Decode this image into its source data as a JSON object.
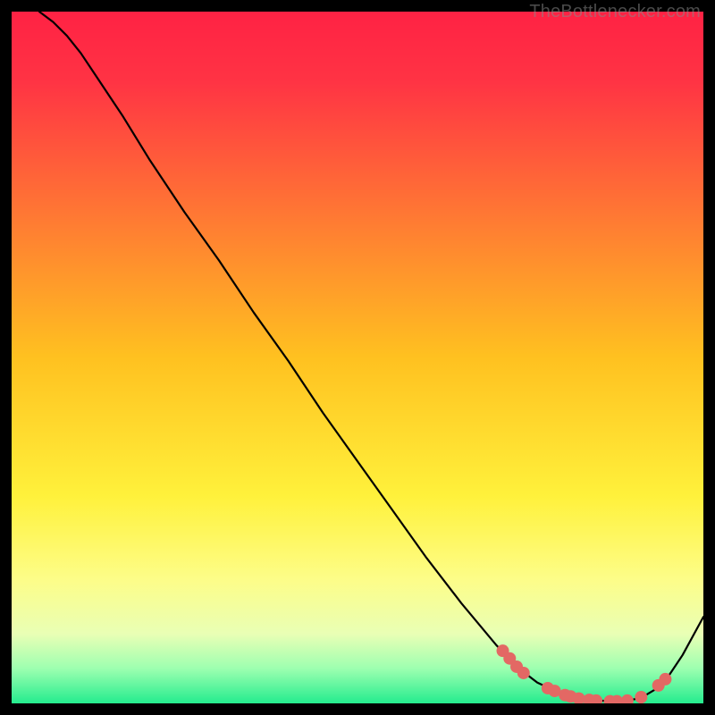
{
  "watermark": "TheBottlenecker.com",
  "chart_data": {
    "type": "line",
    "title": "",
    "xlabel": "",
    "ylabel": "",
    "xlim": [
      0,
      100
    ],
    "ylim": [
      0,
      100
    ],
    "background_gradient_stops": [
      {
        "pct": 0,
        "color": "#ff2244"
      },
      {
        "pct": 10,
        "color": "#ff3344"
      },
      {
        "pct": 30,
        "color": "#ff7a33"
      },
      {
        "pct": 50,
        "color": "#ffc120"
      },
      {
        "pct": 70,
        "color": "#fff13b"
      },
      {
        "pct": 82,
        "color": "#fdfd88"
      },
      {
        "pct": 90,
        "color": "#e9ffb5"
      },
      {
        "pct": 95,
        "color": "#9cffb0"
      },
      {
        "pct": 100,
        "color": "#24ec8e"
      }
    ],
    "series": [
      {
        "name": "bottleneck-curve",
        "color": "#000000",
        "x": [
          4,
          6,
          8,
          10,
          12,
          16,
          20,
          25,
          30,
          35,
          40,
          45,
          50,
          55,
          60,
          65,
          70,
          73,
          76,
          79,
          81,
          83,
          85,
          87,
          89,
          91,
          93,
          95,
          97,
          100
        ],
        "y": [
          100,
          98.5,
          96.5,
          94,
          91,
          85,
          78.5,
          71,
          64,
          56.5,
          49.5,
          42,
          35,
          28,
          21,
          14.5,
          8.5,
          5.3,
          3.0,
          1.6,
          1.0,
          0.6,
          0.4,
          0.3,
          0.4,
          0.8,
          2.0,
          4,
          7,
          12.5
        ]
      }
    ],
    "markers": {
      "name": "highlighted-points",
      "color": "#e36864",
      "radius": 7,
      "points": [
        {
          "x": 71.0,
          "y": 7.6
        },
        {
          "x": 72.0,
          "y": 6.5
        },
        {
          "x": 73.0,
          "y": 5.3
        },
        {
          "x": 74.0,
          "y": 4.4
        },
        {
          "x": 77.5,
          "y": 2.2
        },
        {
          "x": 78.5,
          "y": 1.8
        },
        {
          "x": 80.0,
          "y": 1.2
        },
        {
          "x": 80.8,
          "y": 1.0
        },
        {
          "x": 82.0,
          "y": 0.7
        },
        {
          "x": 83.5,
          "y": 0.5
        },
        {
          "x": 84.5,
          "y": 0.4
        },
        {
          "x": 86.5,
          "y": 0.3
        },
        {
          "x": 87.5,
          "y": 0.3
        },
        {
          "x": 89.0,
          "y": 0.4
        },
        {
          "x": 91.0,
          "y": 0.9
        },
        {
          "x": 93.5,
          "y": 2.6
        },
        {
          "x": 94.5,
          "y": 3.5
        }
      ]
    }
  }
}
